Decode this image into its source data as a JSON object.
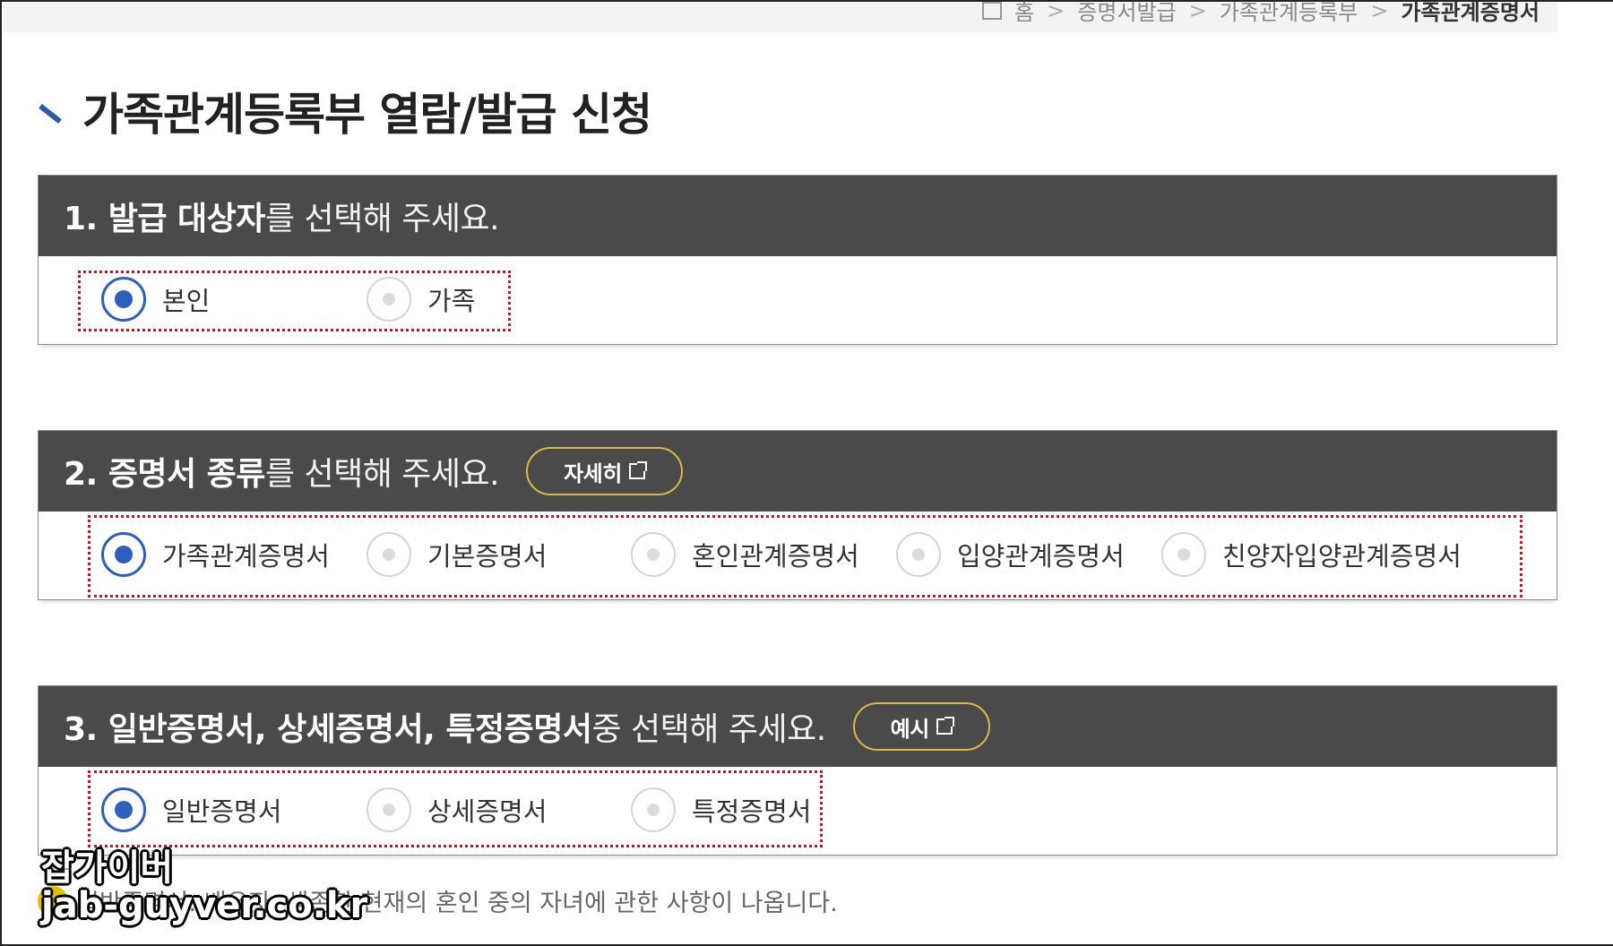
{
  "breadcrumb": {
    "items": [
      "홈",
      "증명서발급",
      "가족관계등록부",
      "가족관계증명서"
    ]
  },
  "page_title": "가족관계등록부 열람/발급 신청",
  "sections": [
    {
      "number_strong": "1. 발급 대상자",
      "rest": "를 선택해 주세요.",
      "options": [
        {
          "label": "본인",
          "selected": true
        },
        {
          "label": "가족",
          "selected": false
        }
      ]
    },
    {
      "number_strong": "2. 증명서 종류",
      "rest": "를 선택해 주세요.",
      "button_label": "자세히",
      "options": [
        {
          "label": "가족관계증명서",
          "selected": true
        },
        {
          "label": "기본증명서",
          "selected": false
        },
        {
          "label": "혼인관계증명서",
          "selected": false
        },
        {
          "label": "입양관계증명서",
          "selected": false
        },
        {
          "label": "친양자입양관계증명서",
          "selected": false
        }
      ]
    },
    {
      "number_strong": "3. 일반증명서, 상세증명서, 특정증명서",
      "rest": " 중 선택해 주세요.",
      "button_label": "예시",
      "options": [
        {
          "label": "일반증명서",
          "selected": true
        },
        {
          "label": "상세증명서",
          "selected": false
        },
        {
          "label": "특정증명서",
          "selected": false
        }
      ]
    }
  ],
  "note": "일반증명서: 배우자, 생존한 현재의 혼인 중의 자녀에 관한 사항이 나옵니다.",
  "watermark": {
    "line1": "잡가이버",
    "line2": "jab-guyver.co.kr"
  },
  "colors": {
    "accent": "#2e5fbd",
    "header_bg": "#4a4a4a",
    "highlight": "#c4161c",
    "pill_border": "#d8b84a"
  }
}
